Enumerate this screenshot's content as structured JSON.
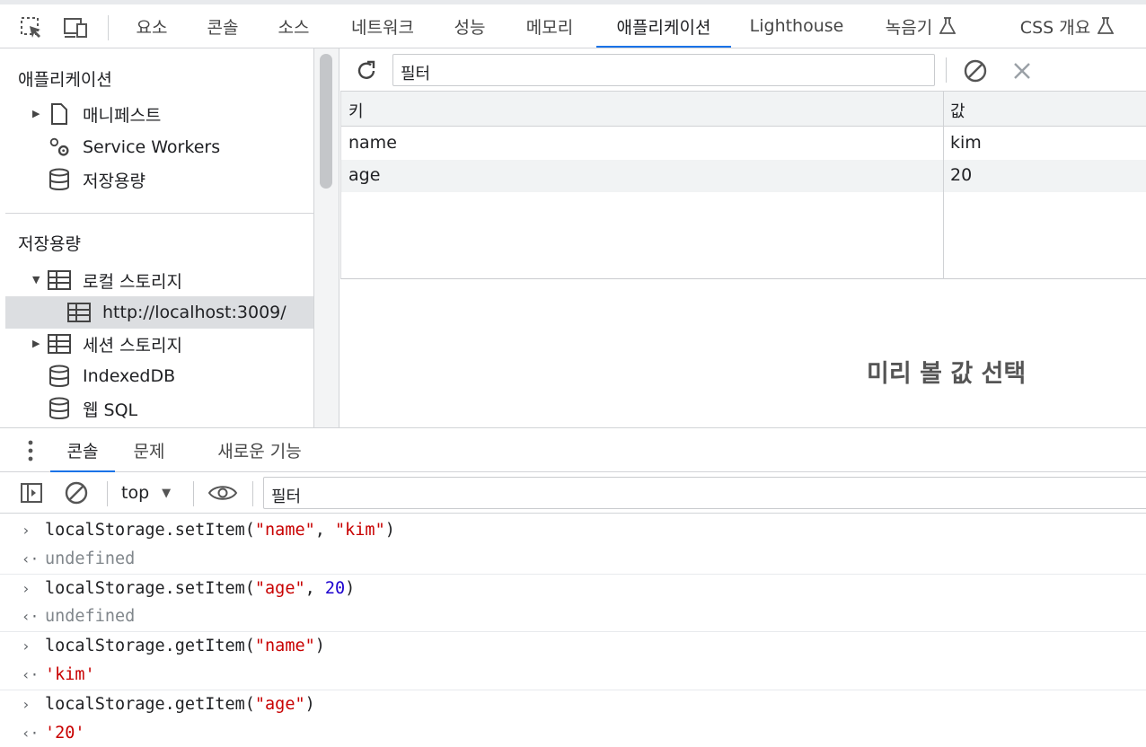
{
  "toolbar": {
    "inspect_icon": "inspect-element-icon",
    "device_icon": "device-toolbar-icon",
    "tabs": [
      "요소",
      "콘솔",
      "소스",
      "네트워크",
      "성능",
      "메모리",
      "애플리케이션",
      "Lighthouse",
      "녹음기",
      "CSS 개요"
    ],
    "active_tab": "애플리케이션"
  },
  "sidebar": {
    "section_app": "애플리케이션",
    "app_items": [
      "매니페스트",
      "Service Workers",
      "저장용량"
    ],
    "section_storage": "저장용량",
    "storage_items": [
      "로컬 스토리지",
      "http://localhost:3009/",
      "세션 스토리지",
      "IndexedDB",
      "웹 SQL"
    ]
  },
  "main": {
    "filter_placeholder": "필터",
    "col_key": "키",
    "col_value": "값",
    "rows": [
      {
        "key": "name",
        "value": "kim"
      },
      {
        "key": "age",
        "value": "20"
      }
    ],
    "preview_text": "미리 볼 값 선택"
  },
  "drawer": {
    "tabs": [
      "콘솔",
      "문제",
      "새로운 기능"
    ],
    "active_tab": "콘솔",
    "context": "top",
    "filter_placeholder": "필터"
  },
  "console": {
    "lines": [
      {
        "kind": "input",
        "parts": [
          [
            "localStorage.setItem(",
            "plain"
          ],
          [
            "\"name\"",
            "str"
          ],
          [
            ", ",
            "plain"
          ],
          [
            "\"kim\"",
            "str"
          ],
          [
            ")",
            "plain"
          ]
        ]
      },
      {
        "kind": "output",
        "parts": [
          [
            "undefined",
            "undef"
          ]
        ]
      },
      {
        "kind": "input",
        "parts": [
          [
            "localStorage.setItem(",
            "plain"
          ],
          [
            "\"age\"",
            "str"
          ],
          [
            ", ",
            "plain"
          ],
          [
            "20",
            "num"
          ],
          [
            ")",
            "plain"
          ]
        ]
      },
      {
        "kind": "output",
        "parts": [
          [
            "undefined",
            "undef"
          ]
        ]
      },
      {
        "kind": "input",
        "parts": [
          [
            "localStorage.getItem(",
            "plain"
          ],
          [
            "\"name\"",
            "str"
          ],
          [
            ")",
            "plain"
          ]
        ]
      },
      {
        "kind": "output",
        "parts": [
          [
            "'kim'",
            "str"
          ]
        ]
      },
      {
        "kind": "input",
        "parts": [
          [
            "localStorage.getItem(",
            "plain"
          ],
          [
            "\"age\"",
            "str"
          ],
          [
            ")",
            "plain"
          ]
        ]
      },
      {
        "kind": "output",
        "parts": [
          [
            "'20'",
            "str"
          ]
        ]
      }
    ]
  },
  "colors": {
    "accent": "#1a73e8",
    "string": "#c80000",
    "number": "#1c00cf",
    "undefined": "#80868b"
  }
}
